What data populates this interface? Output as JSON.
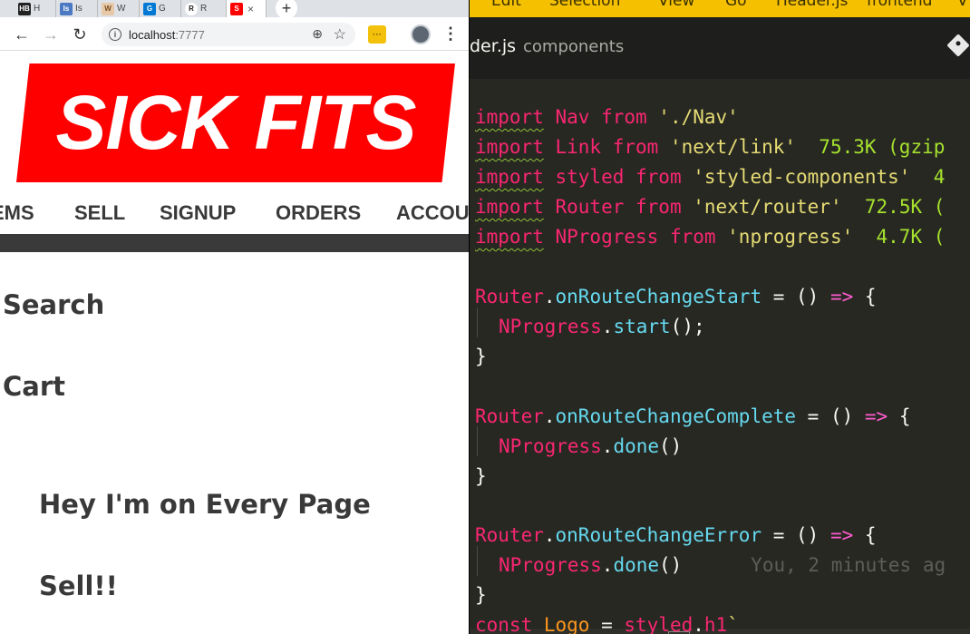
{
  "browser": {
    "tabs": [
      {
        "fav": "HB",
        "fav_color": "#222222",
        "label": "H"
      },
      {
        "fav": "Is",
        "fav_color": "#4a78c2",
        "label": "Is"
      },
      {
        "fav": "W",
        "fav_color": "#e6c9a8",
        "label": "W"
      },
      {
        "fav": "G",
        "fav_color": "#0078d4",
        "label": "G"
      },
      {
        "fav": "R",
        "fav_color": "#ffffff",
        "label": "R"
      },
      {
        "fav": "S",
        "fav_color": "#ff0000",
        "label": ""
      }
    ],
    "active_tab_close": "×",
    "new_tab": "+",
    "back": "←",
    "forward": "→",
    "reload": "↻",
    "url_host": "localhost",
    "url_port": ":7777",
    "info": "i",
    "zoom_icon": "⊕",
    "star_icon": "☆",
    "extension": "···",
    "menu": "⋮"
  },
  "site": {
    "logo": "SICK FITS",
    "nav": [
      "EMS",
      "SELL",
      "SIGNUP",
      "ORDERS",
      "ACCOUNT"
    ],
    "side_links": [
      "Search",
      "Cart"
    ],
    "main_lines": [
      "Hey I'm on Every Page",
      "Sell!!"
    ],
    "logo_color": "#ff0000"
  },
  "editor": {
    "menu": [
      "Edit",
      "Selection",
      "View",
      "Go",
      "Header.js",
      "frontend",
      "V"
    ],
    "file_name": "der.js",
    "file_dir": "components",
    "accent": "#f5c000",
    "code": {
      "l1": [
        "import",
        " Nav ",
        "from",
        " './Nav'"
      ],
      "l2": [
        "import",
        " Link ",
        "from",
        " 'next/link'",
        "  75.3K (gzip"
      ],
      "l3": [
        "import",
        " styled ",
        "from",
        " 'styled-components'",
        "  4"
      ],
      "l4": [
        "import",
        " Router ",
        "from",
        " 'next/router'",
        "  72.5K ("
      ],
      "l5": [
        "import",
        " NProgress ",
        "from",
        " 'nprogress'",
        "  4.7K ("
      ],
      "l6": [
        "Router",
        ".",
        "onRouteChangeStart",
        " = () ",
        "=>",
        " {"
      ],
      "l7": [
        "NProgress",
        ".",
        "start",
        "();"
      ],
      "l8": "}",
      "l9": [
        "Router",
        ".",
        "onRouteChangeComplete",
        " = () ",
        "=>",
        " {"
      ],
      "l10": [
        "NProgress",
        ".",
        "done",
        "()"
      ],
      "l11": "}",
      "l12": [
        "Router",
        ".",
        "onRouteChangeError",
        " = () ",
        "=>",
        " {"
      ],
      "l13": [
        "NProgress",
        ".",
        "done",
        "()",
        "      You, 2 minutes ag"
      ],
      "l14": "}",
      "l15": [
        "const",
        " Logo ",
        "=",
        " styled",
        ".",
        "h1",
        "`"
      ]
    }
  }
}
